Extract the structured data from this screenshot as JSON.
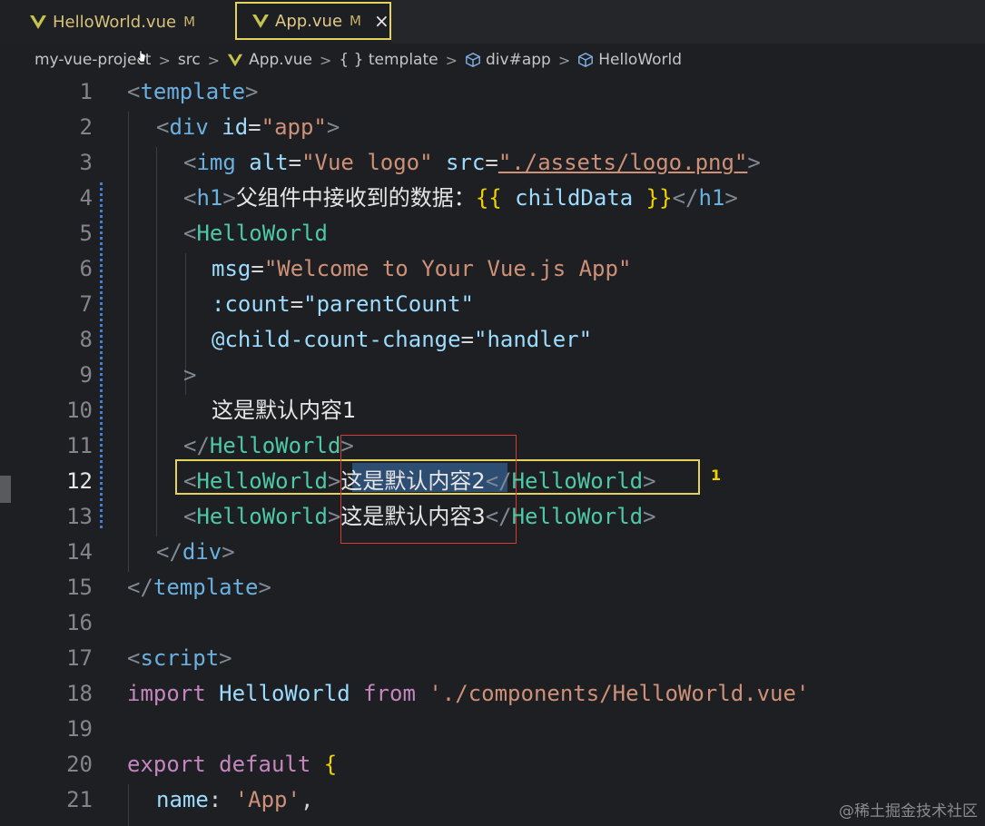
{
  "tabs": [
    {
      "label": "HelloWorld.vue",
      "status": "M"
    },
    {
      "label": "App.vue",
      "status": "M",
      "close": "×"
    }
  ],
  "breadcrumb": {
    "items": [
      "my-vue-project",
      "src",
      "App.vue",
      "{ } template",
      "div#app",
      "HelloWorld"
    ],
    "separator": ">"
  },
  "editor": {
    "line_numbers": [
      "1",
      "2",
      "3",
      "4",
      "5",
      "6",
      "7",
      "8",
      "9",
      "10",
      "11",
      "12",
      "13",
      "14",
      "15",
      "16",
      "17",
      "18",
      "19",
      "20",
      "21"
    ],
    "active_line": "12",
    "lines": {
      "l1": {
        "open": "<",
        "tag": "template",
        "close": ">"
      },
      "l2": {
        "open": "<",
        "tag": "div",
        "attr": "id",
        "eq": "=",
        "val": "\"app\"",
        "close": ">"
      },
      "l3": {
        "open": "<",
        "tag": "img",
        "attr1": "alt",
        "val1": "\"Vue logo\"",
        "attr2": "src",
        "val2": "\"./assets/logo.png\"",
        "close": ">"
      },
      "l4": {
        "open": "<",
        "tag": "h1",
        "close": ">",
        "text": "父组件中接收到的数据：",
        "mus_open": "{{",
        "var": " childData ",
        "mus_close": "}}",
        "end_open": "</",
        "end_tag": "h1",
        "end_close": ">"
      },
      "l5": {
        "open": "<",
        "tag": "HelloWorld"
      },
      "l6": {
        "attr": "msg",
        "eq": "=",
        "val": "\"Welcome to Your Vue.js App\""
      },
      "l7": {
        "attr": ":count",
        "eq": "=",
        "val": "\"parentCount\""
      },
      "l8": {
        "attr": "@child-count-change",
        "eq": "=",
        "val": "\"handler\""
      },
      "l9": {
        "close": ">"
      },
      "l10": {
        "text": "这是默认内容1"
      },
      "l11": {
        "open": "</",
        "tag": "HelloWorld",
        "close": ">"
      },
      "l12": {
        "open": "<",
        "tag": "HelloWorld",
        "close": ">",
        "text": "这是默认内容2",
        "end_open": "</",
        "end_tag": "HelloWorld",
        "end_close": ">"
      },
      "l13": {
        "open": "<",
        "tag": "HelloWorld",
        "close": ">",
        "text": "这是默认内容3",
        "end_open": "</",
        "end_tag": "HelloWorld",
        "end_close": ">"
      },
      "l14": {
        "open": "</",
        "tag": "div",
        "close": ">"
      },
      "l15": {
        "open": "</",
        "tag": "template",
        "close": ">"
      },
      "l17": {
        "open": "<",
        "tag": "script",
        "close": ">"
      },
      "l18": {
        "kw1": "import",
        "name": "HelloWorld",
        "kw2": "from",
        "val": "'./components/HelloWorld.vue'"
      },
      "l20": {
        "kw1": "export",
        "kw2": "default",
        "brace": "{"
      },
      "l21": {
        "prop": "name",
        "colon": ":",
        "val": "'App'",
        "comma": ","
      }
    },
    "problem_badge": "1"
  },
  "watermark": "@稀土掘金技术社区",
  "colors": {
    "accent_yellow": "#e3d35a",
    "selection": "#2d4d73",
    "red_box": "#d93a34"
  }
}
